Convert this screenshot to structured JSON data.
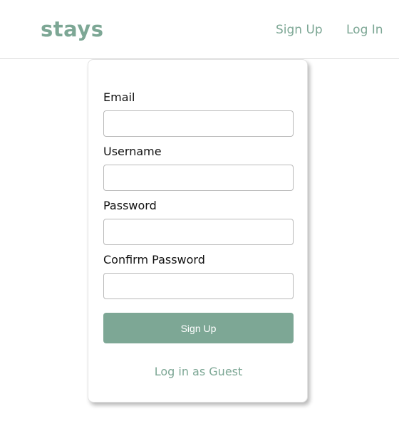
{
  "header": {
    "logo": "stays",
    "nav": {
      "sign_up": "Sign Up",
      "log_in": "Log In"
    }
  },
  "form": {
    "fields": [
      {
        "label": "Email",
        "value": ""
      },
      {
        "label": "Username",
        "value": ""
      },
      {
        "label": "Password",
        "value": ""
      },
      {
        "label": "Confirm Password",
        "value": ""
      }
    ],
    "submit_label": "Sign Up",
    "guest_link": "Log in as Guest"
  },
  "colors": {
    "accent": "#7da795",
    "text": "#111111",
    "border": "#b9b9b9"
  }
}
